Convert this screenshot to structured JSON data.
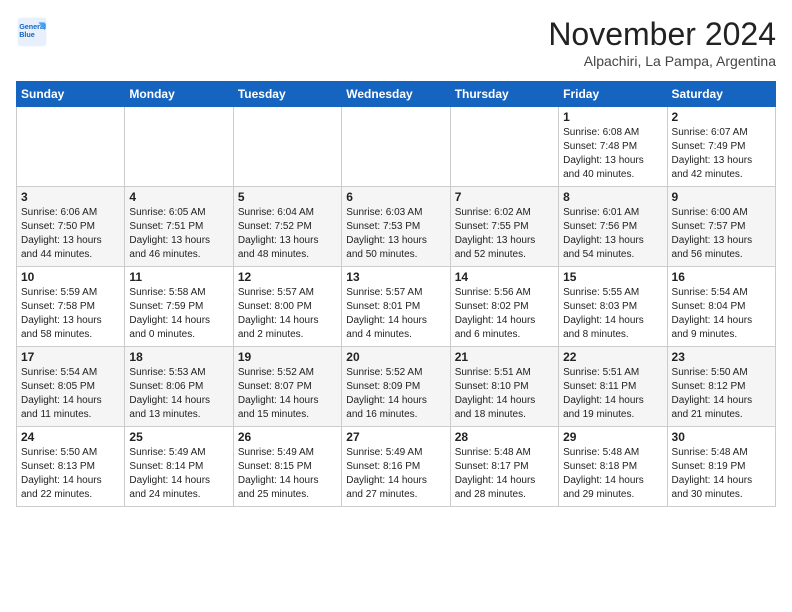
{
  "header": {
    "logo_line1": "General",
    "logo_line2": "Blue",
    "month_title": "November 2024",
    "location": "Alpachiri, La Pampa, Argentina"
  },
  "columns": [
    "Sunday",
    "Monday",
    "Tuesday",
    "Wednesday",
    "Thursday",
    "Friday",
    "Saturday"
  ],
  "weeks": [
    [
      {
        "day": "",
        "info": ""
      },
      {
        "day": "",
        "info": ""
      },
      {
        "day": "",
        "info": ""
      },
      {
        "day": "",
        "info": ""
      },
      {
        "day": "",
        "info": ""
      },
      {
        "day": "1",
        "info": "Sunrise: 6:08 AM\nSunset: 7:48 PM\nDaylight: 13 hours\nand 40 minutes."
      },
      {
        "day": "2",
        "info": "Sunrise: 6:07 AM\nSunset: 7:49 PM\nDaylight: 13 hours\nand 42 minutes."
      }
    ],
    [
      {
        "day": "3",
        "info": "Sunrise: 6:06 AM\nSunset: 7:50 PM\nDaylight: 13 hours\nand 44 minutes."
      },
      {
        "day": "4",
        "info": "Sunrise: 6:05 AM\nSunset: 7:51 PM\nDaylight: 13 hours\nand 46 minutes."
      },
      {
        "day": "5",
        "info": "Sunrise: 6:04 AM\nSunset: 7:52 PM\nDaylight: 13 hours\nand 48 minutes."
      },
      {
        "day": "6",
        "info": "Sunrise: 6:03 AM\nSunset: 7:53 PM\nDaylight: 13 hours\nand 50 minutes."
      },
      {
        "day": "7",
        "info": "Sunrise: 6:02 AM\nSunset: 7:55 PM\nDaylight: 13 hours\nand 52 minutes."
      },
      {
        "day": "8",
        "info": "Sunrise: 6:01 AM\nSunset: 7:56 PM\nDaylight: 13 hours\nand 54 minutes."
      },
      {
        "day": "9",
        "info": "Sunrise: 6:00 AM\nSunset: 7:57 PM\nDaylight: 13 hours\nand 56 minutes."
      }
    ],
    [
      {
        "day": "10",
        "info": "Sunrise: 5:59 AM\nSunset: 7:58 PM\nDaylight: 13 hours\nand 58 minutes."
      },
      {
        "day": "11",
        "info": "Sunrise: 5:58 AM\nSunset: 7:59 PM\nDaylight: 14 hours\nand 0 minutes."
      },
      {
        "day": "12",
        "info": "Sunrise: 5:57 AM\nSunset: 8:00 PM\nDaylight: 14 hours\nand 2 minutes."
      },
      {
        "day": "13",
        "info": "Sunrise: 5:57 AM\nSunset: 8:01 PM\nDaylight: 14 hours\nand 4 minutes."
      },
      {
        "day": "14",
        "info": "Sunrise: 5:56 AM\nSunset: 8:02 PM\nDaylight: 14 hours\nand 6 minutes."
      },
      {
        "day": "15",
        "info": "Sunrise: 5:55 AM\nSunset: 8:03 PM\nDaylight: 14 hours\nand 8 minutes."
      },
      {
        "day": "16",
        "info": "Sunrise: 5:54 AM\nSunset: 8:04 PM\nDaylight: 14 hours\nand 9 minutes."
      }
    ],
    [
      {
        "day": "17",
        "info": "Sunrise: 5:54 AM\nSunset: 8:05 PM\nDaylight: 14 hours\nand 11 minutes."
      },
      {
        "day": "18",
        "info": "Sunrise: 5:53 AM\nSunset: 8:06 PM\nDaylight: 14 hours\nand 13 minutes."
      },
      {
        "day": "19",
        "info": "Sunrise: 5:52 AM\nSunset: 8:07 PM\nDaylight: 14 hours\nand 15 minutes."
      },
      {
        "day": "20",
        "info": "Sunrise: 5:52 AM\nSunset: 8:09 PM\nDaylight: 14 hours\nand 16 minutes."
      },
      {
        "day": "21",
        "info": "Sunrise: 5:51 AM\nSunset: 8:10 PM\nDaylight: 14 hours\nand 18 minutes."
      },
      {
        "day": "22",
        "info": "Sunrise: 5:51 AM\nSunset: 8:11 PM\nDaylight: 14 hours\nand 19 minutes."
      },
      {
        "day": "23",
        "info": "Sunrise: 5:50 AM\nSunset: 8:12 PM\nDaylight: 14 hours\nand 21 minutes."
      }
    ],
    [
      {
        "day": "24",
        "info": "Sunrise: 5:50 AM\nSunset: 8:13 PM\nDaylight: 14 hours\nand 22 minutes."
      },
      {
        "day": "25",
        "info": "Sunrise: 5:49 AM\nSunset: 8:14 PM\nDaylight: 14 hours\nand 24 minutes."
      },
      {
        "day": "26",
        "info": "Sunrise: 5:49 AM\nSunset: 8:15 PM\nDaylight: 14 hours\nand 25 minutes."
      },
      {
        "day": "27",
        "info": "Sunrise: 5:49 AM\nSunset: 8:16 PM\nDaylight: 14 hours\nand 27 minutes."
      },
      {
        "day": "28",
        "info": "Sunrise: 5:48 AM\nSunset: 8:17 PM\nDaylight: 14 hours\nand 28 minutes."
      },
      {
        "day": "29",
        "info": "Sunrise: 5:48 AM\nSunset: 8:18 PM\nDaylight: 14 hours\nand 29 minutes."
      },
      {
        "day": "30",
        "info": "Sunrise: 5:48 AM\nSunset: 8:19 PM\nDaylight: 14 hours\nand 30 minutes."
      }
    ]
  ]
}
